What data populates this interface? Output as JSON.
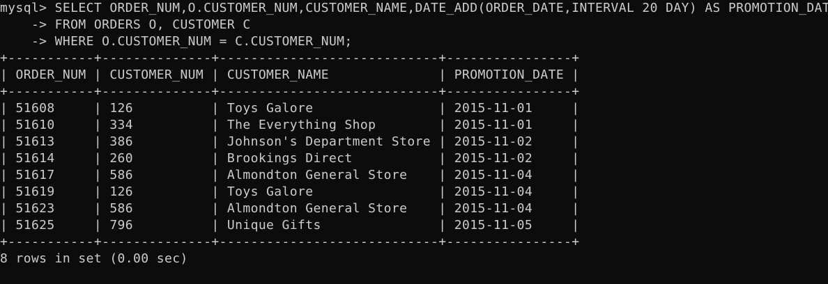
{
  "terminal": {
    "lines": [
      "mysql> SELECT ORDER_NUM,O.CUSTOMER_NUM,CUSTOMER_NAME,DATE_ADD(ORDER_DATE,INTERVAL 20 DAY) AS PROMOTION_DATE",
      "    -> FROM ORDERS O, CUSTOMER C",
      "    -> WHERE O.CUSTOMER_NUM = C.CUSTOMER_NUM;",
      "+-----------+--------------+----------------------------+----------------+",
      "| ORDER_NUM | CUSTOMER_NUM | CUSTOMER_NAME              | PROMOTION_DATE |",
      "+-----------+--------------+----------------------------+----------------+",
      "| 51608     | 126          | Toys Galore                | 2015-11-01     |",
      "| 51610     | 334          | The Everything Shop        | 2015-11-01     |",
      "| 51613     | 386          | Johnson's Department Store | 2015-11-02     |",
      "| 51614     | 260          | Brookings Direct           | 2015-11-02     |",
      "| 51617     | 586          | Almondton General Store    | 2015-11-04     |",
      "| 51619     | 126          | Toys Galore                | 2015-11-04     |",
      "| 51623     | 586          | Almondton General Store    | 2015-11-04     |",
      "| 51625     | 796          | Unique Gifts               | 2015-11-05     |",
      "+-----------+--------------+----------------------------+----------------+",
      "8 rows in set (0.00 sec)",
      ""
    ]
  }
}
